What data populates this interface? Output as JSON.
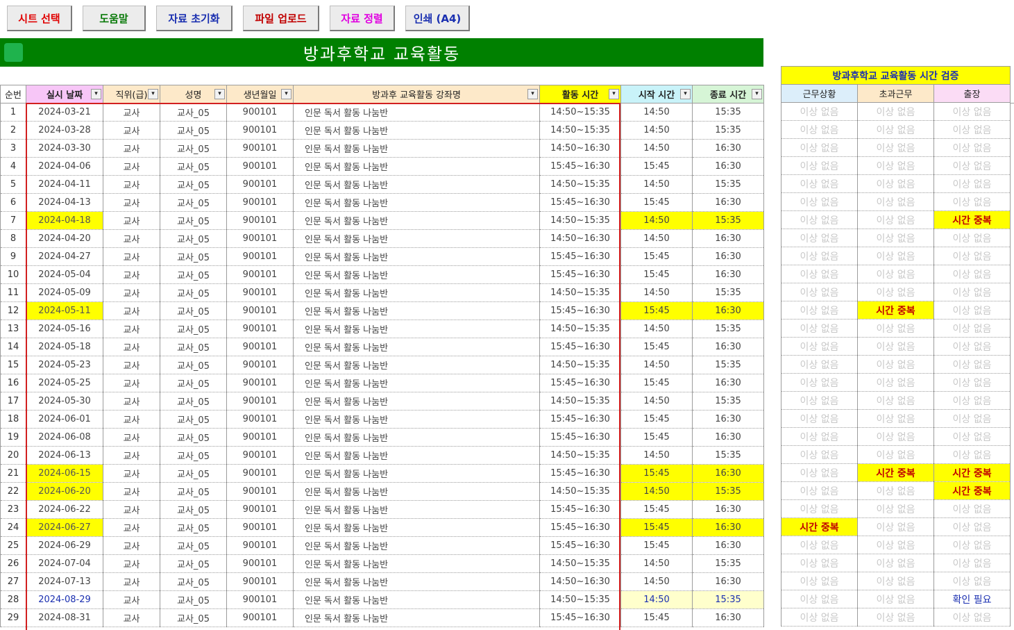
{
  "toolbar": {
    "buttons": [
      {
        "label": "시트 선택",
        "color": "#e00000"
      },
      {
        "label": "도움말",
        "color": "#0a7a0a"
      },
      {
        "label": "자료 초기화",
        "color": "#1a2fb0"
      },
      {
        "label": "파일 업로드",
        "color": "#c00000"
      },
      {
        "label": "자료 정렬",
        "color": "#e000e0"
      },
      {
        "label": "인쇄 (A4)",
        "color": "#1a2fb0"
      }
    ]
  },
  "title": "방과후학교 교육활동",
  "colors": {
    "title_bg": "#008000",
    "highlight": "#ffff00",
    "duplicate_text": "#c00000",
    "confirm_text": "#1a2fb0",
    "frame": "#d22020"
  },
  "columns": [
    {
      "label": "순번",
      "bg": "#ffffff",
      "filter": false,
      "bold": false
    },
    {
      "label": "실시 날짜",
      "bg": "#f7c6f7",
      "filter": true,
      "bold": true
    },
    {
      "label": "직위(급)",
      "bg": "#fde9c9",
      "filter": true,
      "bold": false
    },
    {
      "label": "성명",
      "bg": "#fde9c9",
      "filter": true,
      "bold": false
    },
    {
      "label": "생년월일",
      "bg": "#fde9c9",
      "filter": true,
      "bold": false
    },
    {
      "label": "방과후 교육활동 강좌명",
      "bg": "#fde9c9",
      "filter": true,
      "bold": false
    },
    {
      "label": "활동 시간",
      "bg": "#ffff00",
      "filter": true,
      "bold": true
    },
    {
      "label": "시작 시간",
      "bg": "#c9f3f9",
      "filter": true,
      "bold": true
    },
    {
      "label": "종료 시간",
      "bg": "#d6f5d6",
      "filter": true,
      "bold": true
    }
  ],
  "check_panel": {
    "title": "방과후학교 교육활동 시간 검증",
    "columns": [
      {
        "label": "근무상황",
        "bg": "#dceefa"
      },
      {
        "label": "초과근무",
        "bg": "#fde9c9"
      },
      {
        "label": "출장",
        "bg": "#fbdcf5"
      }
    ]
  },
  "rows": [
    {
      "no": "1",
      "date": "2024-03-21",
      "position": "교사",
      "name": "교사_05",
      "birth": "900101",
      "course": "인문 독서 활동 나눔반",
      "time": "14:50~15:35",
      "start": "14:50",
      "end": "15:35",
      "hl": false,
      "confirm": false,
      "checks": [
        "이상 없음",
        "이상 없음",
        "이상 없음"
      ]
    },
    {
      "no": "2",
      "date": "2024-03-28",
      "position": "교사",
      "name": "교사_05",
      "birth": "900101",
      "course": "인문 독서 활동 나눔반",
      "time": "14:50~15:35",
      "start": "14:50",
      "end": "15:35",
      "hl": false,
      "confirm": false,
      "checks": [
        "이상 없음",
        "이상 없음",
        "이상 없음"
      ]
    },
    {
      "no": "3",
      "date": "2024-03-30",
      "position": "교사",
      "name": "교사_05",
      "birth": "900101",
      "course": "인문 독서 활동 나눔반",
      "time": "14:50~16:30",
      "start": "14:50",
      "end": "16:30",
      "hl": false,
      "confirm": false,
      "checks": [
        "이상 없음",
        "이상 없음",
        "이상 없음"
      ]
    },
    {
      "no": "4",
      "date": "2024-04-06",
      "position": "교사",
      "name": "교사_05",
      "birth": "900101",
      "course": "인문 독서 활동 나눔반",
      "time": "15:45~16:30",
      "start": "15:45",
      "end": "16:30",
      "hl": false,
      "confirm": false,
      "checks": [
        "이상 없음",
        "이상 없음",
        "이상 없음"
      ]
    },
    {
      "no": "5",
      "date": "2024-04-11",
      "position": "교사",
      "name": "교사_05",
      "birth": "900101",
      "course": "인문 독서 활동 나눔반",
      "time": "14:50~15:35",
      "start": "14:50",
      "end": "15:35",
      "hl": false,
      "confirm": false,
      "checks": [
        "이상 없음",
        "이상 없음",
        "이상 없음"
      ]
    },
    {
      "no": "6",
      "date": "2024-04-13",
      "position": "교사",
      "name": "교사_05",
      "birth": "900101",
      "course": "인문 독서 활동 나눔반",
      "time": "15:45~16:30",
      "start": "15:45",
      "end": "16:30",
      "hl": false,
      "confirm": false,
      "checks": [
        "이상 없음",
        "이상 없음",
        "이상 없음"
      ]
    },
    {
      "no": "7",
      "date": "2024-04-18",
      "position": "교사",
      "name": "교사_05",
      "birth": "900101",
      "course": "인문 독서 활동 나눔반",
      "time": "14:50~15:35",
      "start": "14:50",
      "end": "15:35",
      "hl": true,
      "confirm": false,
      "checks": [
        "이상 없음",
        "이상 없음",
        "시간 중복"
      ]
    },
    {
      "no": "8",
      "date": "2024-04-20",
      "position": "교사",
      "name": "교사_05",
      "birth": "900101",
      "course": "인문 독서 활동 나눔반",
      "time": "14:50~16:30",
      "start": "14:50",
      "end": "16:30",
      "hl": false,
      "confirm": false,
      "checks": [
        "이상 없음",
        "이상 없음",
        "이상 없음"
      ]
    },
    {
      "no": "9",
      "date": "2024-04-27",
      "position": "교사",
      "name": "교사_05",
      "birth": "900101",
      "course": "인문 독서 활동 나눔반",
      "time": "15:45~16:30",
      "start": "15:45",
      "end": "16:30",
      "hl": false,
      "confirm": false,
      "checks": [
        "이상 없음",
        "이상 없음",
        "이상 없음"
      ]
    },
    {
      "no": "10",
      "date": "2024-05-04",
      "position": "교사",
      "name": "교사_05",
      "birth": "900101",
      "course": "인문 독서 활동 나눔반",
      "time": "15:45~16:30",
      "start": "15:45",
      "end": "16:30",
      "hl": false,
      "confirm": false,
      "checks": [
        "이상 없음",
        "이상 없음",
        "이상 없음"
      ]
    },
    {
      "no": "11",
      "date": "2024-05-09",
      "position": "교사",
      "name": "교사_05",
      "birth": "900101",
      "course": "인문 독서 활동 나눔반",
      "time": "14:50~15:35",
      "start": "14:50",
      "end": "15:35",
      "hl": false,
      "confirm": false,
      "checks": [
        "이상 없음",
        "이상 없음",
        "이상 없음"
      ]
    },
    {
      "no": "12",
      "date": "2024-05-11",
      "position": "교사",
      "name": "교사_05",
      "birth": "900101",
      "course": "인문 독서 활동 나눔반",
      "time": "15:45~16:30",
      "start": "15:45",
      "end": "16:30",
      "hl": true,
      "confirm": false,
      "checks": [
        "이상 없음",
        "시간 중복",
        "이상 없음"
      ]
    },
    {
      "no": "13",
      "date": "2024-05-16",
      "position": "교사",
      "name": "교사_05",
      "birth": "900101",
      "course": "인문 독서 활동 나눔반",
      "time": "14:50~15:35",
      "start": "14:50",
      "end": "15:35",
      "hl": false,
      "confirm": false,
      "checks": [
        "이상 없음",
        "이상 없음",
        "이상 없음"
      ]
    },
    {
      "no": "14",
      "date": "2024-05-18",
      "position": "교사",
      "name": "교사_05",
      "birth": "900101",
      "course": "인문 독서 활동 나눔반",
      "time": "15:45~16:30",
      "start": "15:45",
      "end": "16:30",
      "hl": false,
      "confirm": false,
      "checks": [
        "이상 없음",
        "이상 없음",
        "이상 없음"
      ]
    },
    {
      "no": "15",
      "date": "2024-05-23",
      "position": "교사",
      "name": "교사_05",
      "birth": "900101",
      "course": "인문 독서 활동 나눔반",
      "time": "14:50~15:35",
      "start": "14:50",
      "end": "15:35",
      "hl": false,
      "confirm": false,
      "checks": [
        "이상 없음",
        "이상 없음",
        "이상 없음"
      ]
    },
    {
      "no": "16",
      "date": "2024-05-25",
      "position": "교사",
      "name": "교사_05",
      "birth": "900101",
      "course": "인문 독서 활동 나눔반",
      "time": "15:45~16:30",
      "start": "15:45",
      "end": "16:30",
      "hl": false,
      "confirm": false,
      "checks": [
        "이상 없음",
        "이상 없음",
        "이상 없음"
      ]
    },
    {
      "no": "17",
      "date": "2024-05-30",
      "position": "교사",
      "name": "교사_05",
      "birth": "900101",
      "course": "인문 독서 활동 나눔반",
      "time": "14:50~15:35",
      "start": "14:50",
      "end": "15:35",
      "hl": false,
      "confirm": false,
      "checks": [
        "이상 없음",
        "이상 없음",
        "이상 없음"
      ]
    },
    {
      "no": "18",
      "date": "2024-06-01",
      "position": "교사",
      "name": "교사_05",
      "birth": "900101",
      "course": "인문 독서 활동 나눔반",
      "time": "15:45~16:30",
      "start": "15:45",
      "end": "16:30",
      "hl": false,
      "confirm": false,
      "checks": [
        "이상 없음",
        "이상 없음",
        "이상 없음"
      ]
    },
    {
      "no": "19",
      "date": "2024-06-08",
      "position": "교사",
      "name": "교사_05",
      "birth": "900101",
      "course": "인문 독서 활동 나눔반",
      "time": "15:45~16:30",
      "start": "15:45",
      "end": "16:30",
      "hl": false,
      "confirm": false,
      "checks": [
        "이상 없음",
        "이상 없음",
        "이상 없음"
      ]
    },
    {
      "no": "20",
      "date": "2024-06-13",
      "position": "교사",
      "name": "교사_05",
      "birth": "900101",
      "course": "인문 독서 활동 나눔반",
      "time": "14:50~15:35",
      "start": "14:50",
      "end": "15:35",
      "hl": false,
      "confirm": false,
      "checks": [
        "이상 없음",
        "이상 없음",
        "이상 없음"
      ]
    },
    {
      "no": "21",
      "date": "2024-06-15",
      "position": "교사",
      "name": "교사_05",
      "birth": "900101",
      "course": "인문 독서 활동 나눔반",
      "time": "15:45~16:30",
      "start": "15:45",
      "end": "16:30",
      "hl": true,
      "confirm": false,
      "checks": [
        "이상 없음",
        "시간 중복",
        "시간 중복"
      ]
    },
    {
      "no": "22",
      "date": "2024-06-20",
      "position": "교사",
      "name": "교사_05",
      "birth": "900101",
      "course": "인문 독서 활동 나눔반",
      "time": "14:50~15:35",
      "start": "14:50",
      "end": "15:35",
      "hl": true,
      "confirm": false,
      "checks": [
        "이상 없음",
        "이상 없음",
        "시간 중복"
      ]
    },
    {
      "no": "23",
      "date": "2024-06-22",
      "position": "교사",
      "name": "교사_05",
      "birth": "900101",
      "course": "인문 독서 활동 나눔반",
      "time": "15:45~16:30",
      "start": "15:45",
      "end": "16:30",
      "hl": false,
      "confirm": false,
      "checks": [
        "이상 없음",
        "이상 없음",
        "이상 없음"
      ]
    },
    {
      "no": "24",
      "date": "2024-06-27",
      "position": "교사",
      "name": "교사_05",
      "birth": "900101",
      "course": "인문 독서 활동 나눔반",
      "time": "15:45~16:30",
      "start": "15:45",
      "end": "16:30",
      "hl": true,
      "confirm": false,
      "checks": [
        "시간 중복",
        "이상 없음",
        "이상 없음"
      ]
    },
    {
      "no": "25",
      "date": "2024-06-29",
      "position": "교사",
      "name": "교사_05",
      "birth": "900101",
      "course": "인문 독서 활동 나눔반",
      "time": "15:45~16:30",
      "start": "15:45",
      "end": "16:30",
      "hl": false,
      "confirm": false,
      "checks": [
        "이상 없음",
        "이상 없음",
        "이상 없음"
      ]
    },
    {
      "no": "26",
      "date": "2024-07-04",
      "position": "교사",
      "name": "교사_05",
      "birth": "900101",
      "course": "인문 독서 활동 나눔반",
      "time": "14:50~15:35",
      "start": "14:50",
      "end": "15:35",
      "hl": false,
      "confirm": false,
      "checks": [
        "이상 없음",
        "이상 없음",
        "이상 없음"
      ]
    },
    {
      "no": "27",
      "date": "2024-07-13",
      "position": "교사",
      "name": "교사_05",
      "birth": "900101",
      "course": "인문 독서 활동 나눔반",
      "time": "14:50~16:30",
      "start": "14:50",
      "end": "16:30",
      "hl": false,
      "confirm": false,
      "checks": [
        "이상 없음",
        "이상 없음",
        "이상 없음"
      ]
    },
    {
      "no": "28",
      "date": "2024-08-29",
      "position": "교사",
      "name": "교사_05",
      "birth": "900101",
      "course": "인문 독서 활동 나눔반",
      "time": "14:50~15:35",
      "start": "14:50",
      "end": "15:35",
      "hl": false,
      "confirm": true,
      "checks": [
        "이상 없음",
        "이상 없음",
        "확인 필요"
      ]
    },
    {
      "no": "29",
      "date": "2024-08-31",
      "position": "교사",
      "name": "교사_05",
      "birth": "900101",
      "course": "인문 독서 활동 나눔반",
      "time": "15:45~16:30",
      "start": "15:45",
      "end": "16:30",
      "hl": false,
      "confirm": false,
      "checks": [
        "이상 없음",
        "이상 없음",
        "이상 없음"
      ]
    }
  ]
}
